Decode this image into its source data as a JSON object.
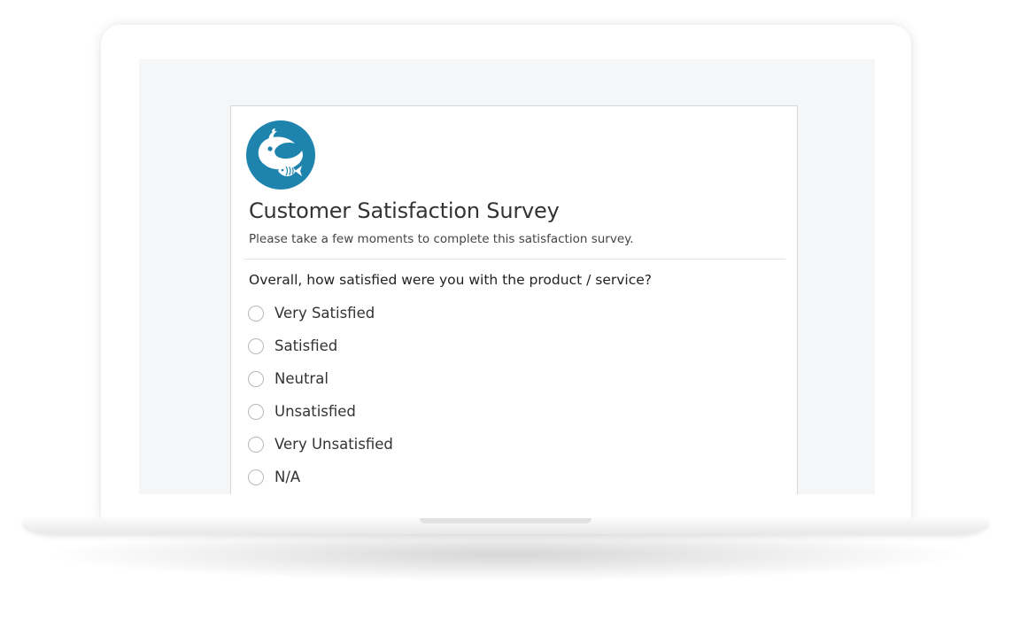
{
  "survey": {
    "title": "Customer Satisfaction Survey",
    "description": "Please take a few moments to complete this satisfaction survey.",
    "logo_icon": "wave-fish-logo-icon",
    "brand_color": "#1f84ad",
    "question": {
      "text": "Overall, how satisfied were you with the product / service?",
      "options": [
        {
          "label": "Very Satisfied",
          "selected": false
        },
        {
          "label": "Satisfied",
          "selected": false
        },
        {
          "label": "Neutral",
          "selected": false
        },
        {
          "label": "Unsatisfied",
          "selected": false
        },
        {
          "label": "Very Unsatisfied",
          "selected": false
        },
        {
          "label": "N/A",
          "selected": false
        }
      ]
    }
  }
}
